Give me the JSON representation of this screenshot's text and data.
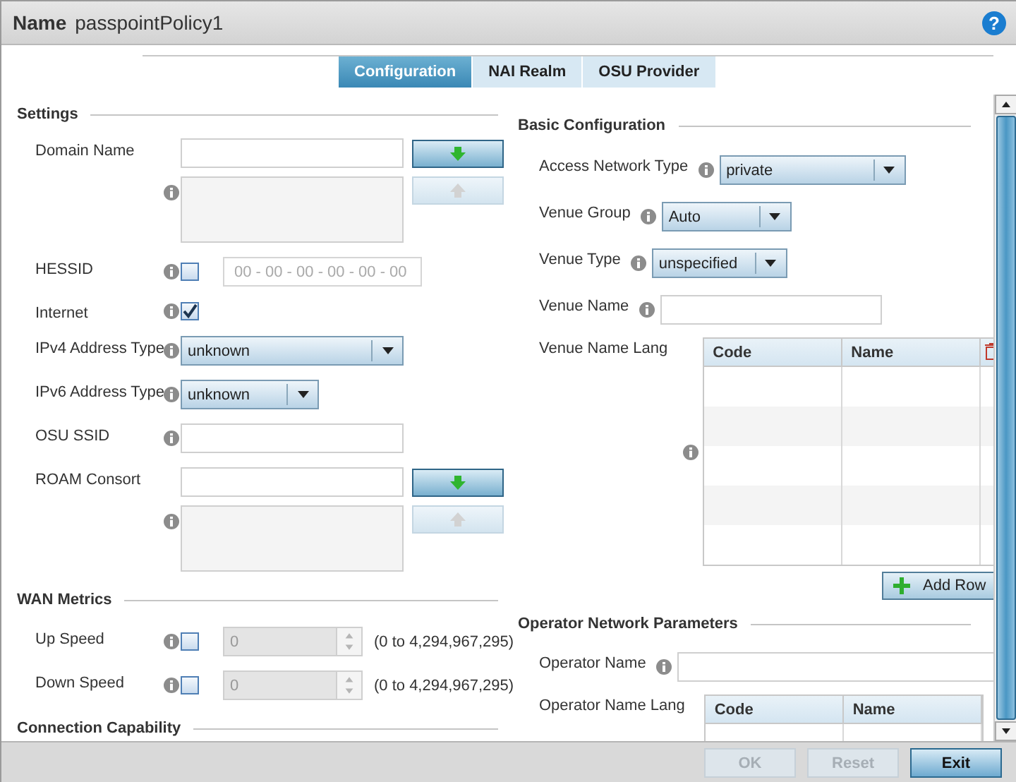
{
  "header": {
    "label": "Name",
    "value": "passpointPolicy1",
    "help": "?"
  },
  "tabs": [
    {
      "label": "Configuration",
      "selected": true
    },
    {
      "label": "NAI Realm",
      "selected": false
    },
    {
      "label": "OSU Provider",
      "selected": false
    }
  ],
  "left_sections": [
    {
      "title": "Settings",
      "rows": [
        {
          "kind": "list",
          "label": "Domain Name"
        },
        {
          "kind": "check_field",
          "label": "HESSID",
          "checked": false,
          "placeholder": "00 - 00 - 00 - 00 - 00 - 00"
        },
        {
          "kind": "check",
          "label": "Internet",
          "checked": true
        },
        {
          "kind": "select_wide",
          "label": "IPv4 Address Type",
          "value": "unknown"
        },
        {
          "kind": "select",
          "label": "IPv6 Address Type",
          "value": "unknown"
        },
        {
          "kind": "text",
          "label": "OSU SSID"
        },
        {
          "kind": "list",
          "label": "ROAM Consort"
        }
      ]
    },
    {
      "title": "WAN Metrics",
      "rows": [
        {
          "kind": "spinner",
          "label": "Up Speed",
          "checked": false,
          "value": "0",
          "range": "(0 to 4,294,967,295)"
        },
        {
          "kind": "spinner",
          "label": "Down Speed",
          "checked": false,
          "value": "0",
          "range": "(0 to 4,294,967,295)"
        }
      ]
    },
    {
      "title": "Connection Capability"
    }
  ],
  "right_sections": [
    {
      "title": "Basic Configuration",
      "rows": [
        {
          "kind": "select_wide",
          "label": "Access Network Type",
          "value": "private"
        },
        {
          "kind": "select",
          "label": "Venue Group",
          "value": "Auto"
        },
        {
          "kind": "select",
          "label": "Venue Type",
          "value": "unspecified"
        },
        {
          "kind": "text",
          "label": "Venue Name"
        },
        {
          "kind": "table",
          "label": "Venue Name Lang",
          "columns": [
            "Code",
            "Name"
          ]
        },
        {
          "kind": "add_button",
          "label": "Add Row"
        }
      ]
    },
    {
      "title": "Operator Network Parameters",
      "rows": [
        {
          "kind": "wide_text",
          "label": "Operator Name"
        },
        {
          "kind": "table",
          "label": "Operator Name Lang",
          "columns": [
            "Code",
            "Name"
          ]
        }
      ]
    }
  ],
  "footer": {
    "buttons": [
      {
        "label": "OK",
        "disabled": true
      },
      {
        "label": "Reset",
        "disabled": true
      },
      {
        "label": "Exit",
        "disabled": false
      }
    ]
  }
}
